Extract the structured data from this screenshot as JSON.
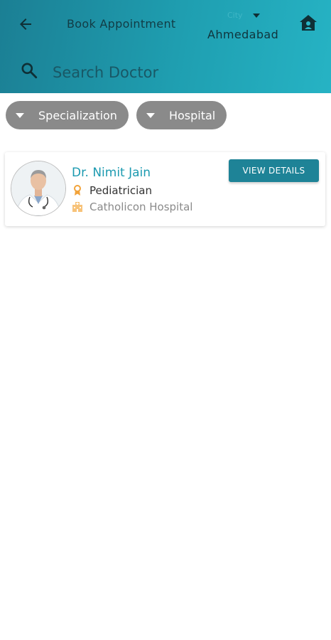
{
  "header": {
    "title": "Book Appointment",
    "city_label": "City",
    "city_value": "Ahmedabad",
    "back_icon": "arrow-left-icon",
    "home_icon": "home-icon"
  },
  "search": {
    "placeholder": "Search Doctor",
    "icon": "search-icon"
  },
  "filters": {
    "chips": [
      "Specialization",
      "Hospital"
    ]
  },
  "doctors": [
    {
      "name": "Dr. Nimit Jain",
      "specialization": "Pediatrician",
      "hospital": "Catholicon Hospital",
      "action_label": "VIEW DETAILS"
    }
  ],
  "colors": {
    "header_start": "#1b7f94",
    "header_end": "#26b3c4",
    "accent": "#1c9ab0",
    "button": "#1e8397",
    "chip": "#8a8a8a",
    "icon_orange": "#f2a33a"
  }
}
